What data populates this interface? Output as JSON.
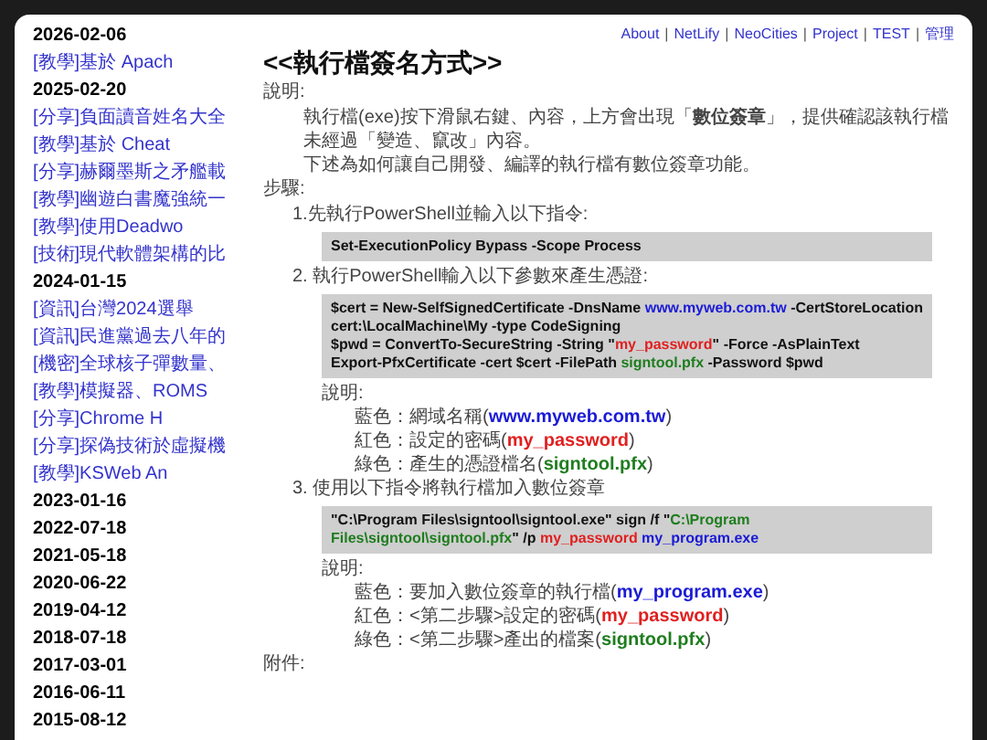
{
  "nav": {
    "separator": "|",
    "links": [
      "About",
      "NetLify",
      "NeoCities",
      "Project",
      "TEST",
      "管理"
    ]
  },
  "sidebar": [
    {
      "date": "2026-02-06",
      "posts": [
        "[教學]基於 Apach"
      ]
    },
    {
      "date": "2025-02-20",
      "posts": [
        "[分享]負面讀音姓名大全",
        "[教學]基於 Cheat",
        "[分享]赫爾墨斯之矛艦載",
        "[教學]幽遊白書魔強統一",
        "[教學]使用Deadwo",
        "[技術]現代軟體架構的比"
      ]
    },
    {
      "date": "2024-01-15",
      "posts": [
        "[資訊]台灣2024選舉",
        "[資訊]民進黨過去八年的",
        "[機密]全球核子彈數量、",
        "[教學]模擬器、ROMS",
        "[分享]Chrome H",
        "[分享]探偽技術於虛擬機",
        "[教學]KSWeb An"
      ]
    },
    {
      "date": "2023-01-16"
    },
    {
      "date": "2022-07-18"
    },
    {
      "date": "2021-05-18"
    },
    {
      "date": "2020-06-22"
    },
    {
      "date": "2019-04-12"
    },
    {
      "date": "2018-07-18"
    },
    {
      "date": "2017-03-01"
    },
    {
      "date": "2016-06-11"
    },
    {
      "date": "2015-08-12"
    }
  ],
  "article": {
    "title": "<<執行檔簽名方式>>",
    "blocks": [
      {
        "kind": "label",
        "text": "說明:"
      },
      {
        "kind": "paragraph",
        "text": "執行檔(exe)按下滑鼠右鍵、內容，上方會出現「**數位簽章**」，提供確認該執行檔未經過「變造、竄改」內容。"
      },
      {
        "kind": "paragraph",
        "text": "下述為如何讓自己開發、編譯的執行檔有數位簽章功能。"
      },
      {
        "kind": "label",
        "text": "步驟:"
      },
      {
        "kind": "step",
        "text": "1.先執行PowerShell並輸入以下指令:"
      },
      {
        "kind": "code",
        "lines": [
          [
            {
              "text": "Set-ExecutionPolicy Bypass -Scope Process"
            }
          ]
        ]
      },
      {
        "kind": "step",
        "text": "2. 執行PowerShell輸入以下參數來產生憑證:"
      },
      {
        "kind": "code",
        "lines": [
          [
            {
              "text": "$cert = New-SelfSignedCertificate -DnsName "
            },
            {
              "text": "www.myweb.com.tw",
              "color": "#1a1ad6"
            },
            {
              "text": " -CertStoreLocation"
            }
          ],
          [
            {
              "text": "cert:\\LocalMachine\\My -type CodeSigning"
            }
          ],
          [
            {
              "text": "$pwd = ConvertTo-SecureString -String \""
            },
            {
              "text": "my_password",
              "color": "#e02020"
            },
            {
              "text": "\" -Force -AsPlainText"
            }
          ],
          [
            {
              "text": "Export-PfxCertificate -cert $cert -FilePath "
            },
            {
              "text": "signtool.pfx",
              "color": "#1e7d1e"
            },
            {
              "text": " -Password $pwd"
            }
          ]
        ]
      },
      {
        "kind": "note",
        "label": "說明:",
        "lines": [
          [
            {
              "text": "藍色：網域名稱("
            },
            {
              "text": "www.myweb.com.tw",
              "color": "#1a1ad6"
            },
            {
              "text": ")"
            }
          ],
          [
            {
              "text": "紅色：設定的密碼("
            },
            {
              "text": "my_password",
              "color": "#e02020"
            },
            {
              "text": ")"
            }
          ],
          [
            {
              "text": "綠色：產生的憑證檔名("
            },
            {
              "text": "signtool.pfx",
              "color": "#1e7d1e"
            },
            {
              "text": ")"
            }
          ]
        ]
      },
      {
        "kind": "step",
        "text": "3. 使用以下指令將執行檔加入數位簽章"
      },
      {
        "kind": "code",
        "lines": [
          [
            {
              "text": "\"C:\\Program Files\\signtool\\signtool.exe\" sign /f \""
            },
            {
              "text": "C:\\Program",
              "color": "#1e7d1e"
            }
          ],
          [
            {
              "text": "Files\\signtool\\signtool.pfx",
              "color": "#1e7d1e"
            },
            {
              "text": "\" /p "
            },
            {
              "text": "my_password",
              "color": "#e02020"
            },
            {
              "text": " my_program.exe",
              "color": "#1a1ad6"
            }
          ]
        ]
      },
      {
        "kind": "note",
        "label": "說明:",
        "lines": [
          [
            {
              "text": "藍色：要加入數位簽章的執行檔("
            },
            {
              "text": "my_program.exe",
              "color": "#1a1ad6"
            },
            {
              "text": ")"
            }
          ],
          [
            {
              "text": "紅色：<第二步驟>設定的密碼("
            },
            {
              "text": "my_password",
              "color": "#e02020"
            },
            {
              "text": ")"
            }
          ],
          [
            {
              "text": "綠色：<第二步驟>產出的檔案("
            },
            {
              "text": "signtool.pfx",
              "color": "#1e7d1e"
            },
            {
              "text": ")"
            }
          ]
        ]
      },
      {
        "kind": "label",
        "text": "附件:"
      }
    ]
  }
}
